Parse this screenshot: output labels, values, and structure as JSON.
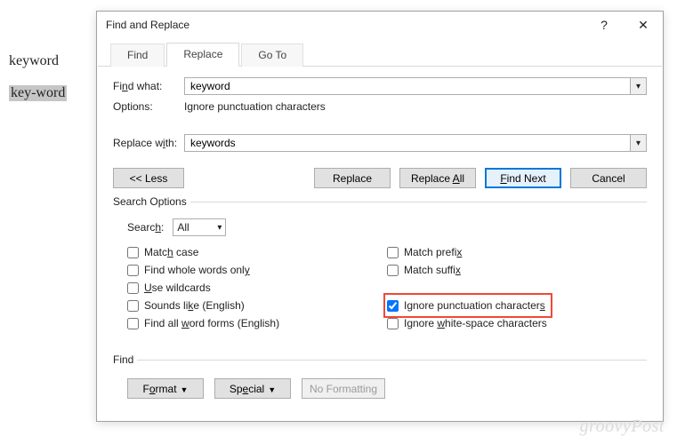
{
  "doc": {
    "word1": "keyword",
    "word2": "key-word"
  },
  "dialog": {
    "title": "Find and Replace",
    "help": "?",
    "close": "✕",
    "tabs": {
      "find": "Find",
      "replace": "Replace",
      "goto": "Go To"
    },
    "find_what_label": "Find what:",
    "find_what_value": "keyword",
    "options_label": "Options:",
    "options_value": "Ignore punctuation characters",
    "replace_with_label": "Replace with:",
    "replace_with_value": "keywords",
    "buttons": {
      "less": "<< Less",
      "replace": "Replace",
      "replace_all": "Replace All",
      "find_next": "Find Next",
      "cancel": "Cancel"
    },
    "search_options_legend": "Search Options",
    "search_label": "Search:",
    "search_value": "All",
    "checks": {
      "match_case": "Match case",
      "whole_words": "Find whole words only",
      "wildcards": "Use wildcards",
      "sounds_like": "Sounds like (English)",
      "word_forms": "Find all word forms (English)",
      "match_prefix": "Match prefix",
      "match_suffix": "Match suffix",
      "ign_punct": "Ignore punctuation characters",
      "ign_ws": "Ignore white-space characters"
    },
    "find_legend": "Find",
    "bottom": {
      "format": "Format",
      "special": "Special",
      "no_formatting": "No Formatting"
    }
  },
  "watermark": "groovyPost"
}
